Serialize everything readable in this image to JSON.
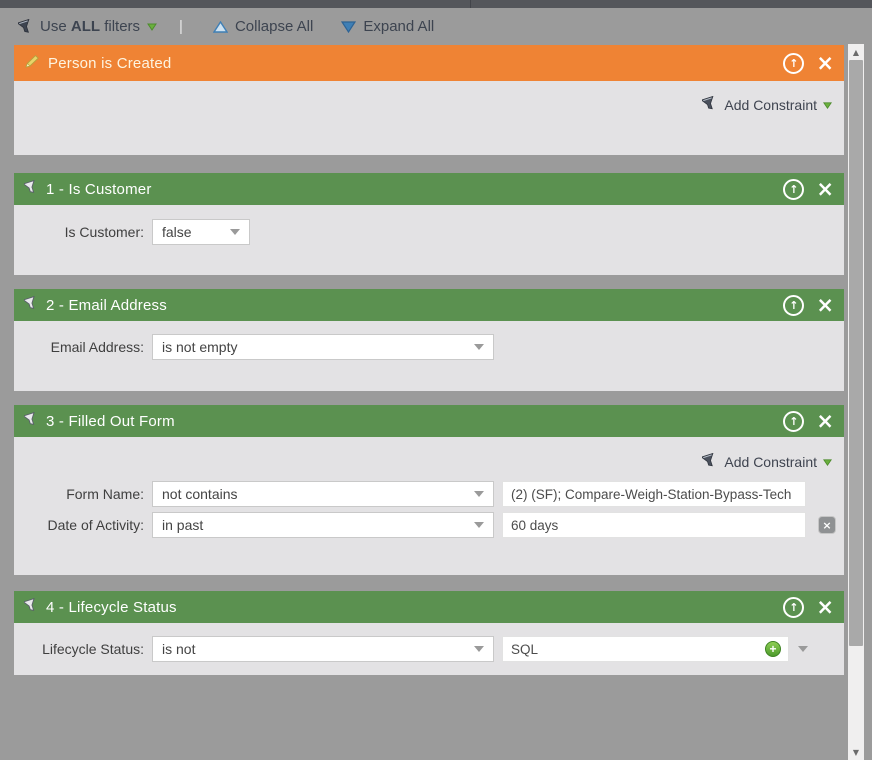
{
  "toolbar": {
    "use": "Use",
    "all": "ALL",
    "filters": "filters",
    "separator": "|",
    "collapse_all": "Collapse All",
    "expand_all": "Expand All"
  },
  "panels": [
    {
      "title": "Person is Created",
      "add_constraint": "Add Constraint"
    },
    {
      "title": "1 - Is Customer",
      "rows": [
        {
          "label": "Is Customer:",
          "operator": "false"
        }
      ]
    },
    {
      "title": "2 - Email Address",
      "rows": [
        {
          "label": "Email Address:",
          "operator": "is not empty"
        }
      ]
    },
    {
      "title": "3 - Filled Out Form",
      "add_constraint": "Add Constraint",
      "rows": [
        {
          "label": "Form Name:",
          "operator": "not contains",
          "value": "(2) (SF); Compare-Weigh-Station-Bypass-Tech"
        },
        {
          "label": "Date of Activity:",
          "operator": "in past",
          "value": "60 days"
        }
      ]
    },
    {
      "title": "4 - Lifecycle Status",
      "rows": [
        {
          "label": "Lifecycle Status:",
          "operator": "is not",
          "value": "SQL"
        }
      ]
    }
  ],
  "colors": {
    "header_orange": "#EF8334",
    "header_green": "#5B9150",
    "page_background": "#9B9B9B",
    "panel_background": "#E3E2E4",
    "accent_green": "#6BB03E",
    "accent_blue": "#3F7FB5"
  }
}
